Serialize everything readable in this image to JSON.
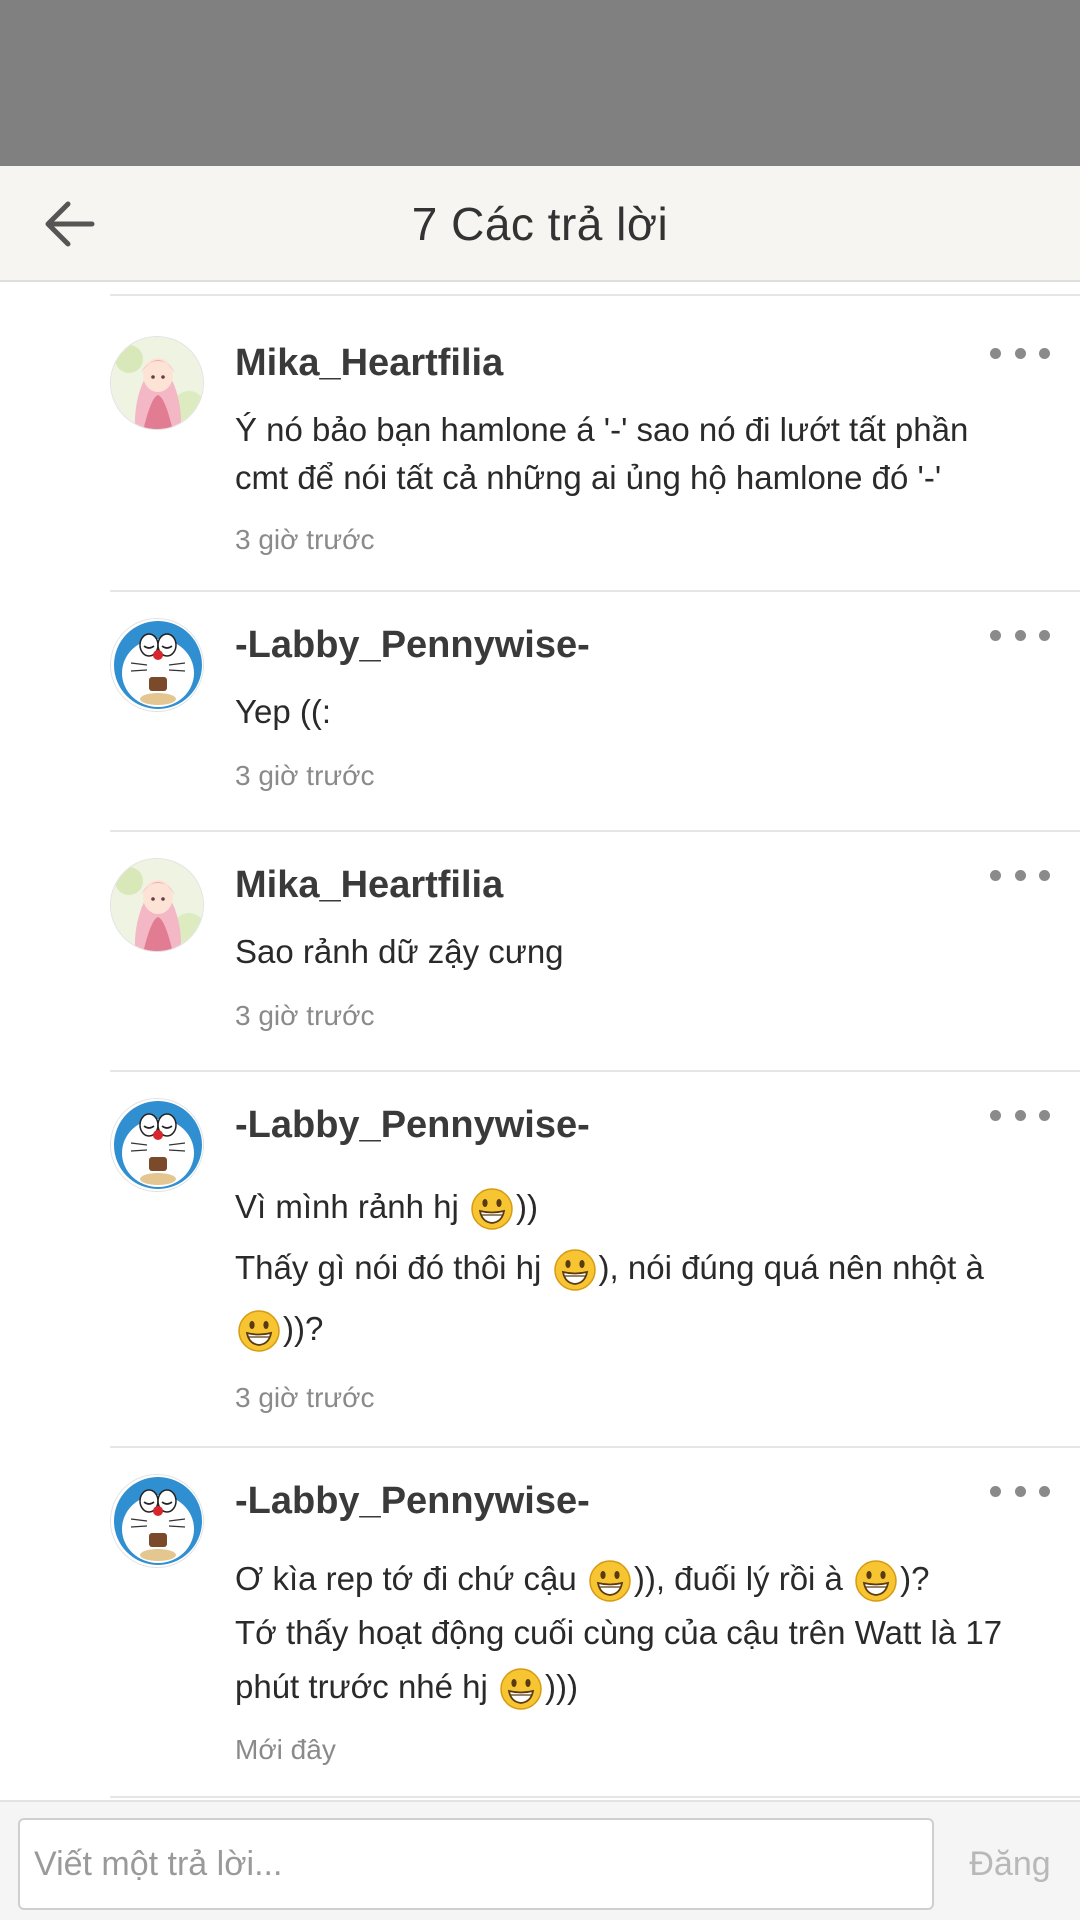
{
  "header": {
    "title": "7 Các trả lời",
    "back_icon": "arrow-left-icon"
  },
  "comments": [
    {
      "username": "Mika_Heartfilia",
      "avatar": "anime-girl-avatar",
      "lines": [
        [
          "Ý nó bảo bạn hamlone á '-' sao nó đi lướt tất phần"
        ],
        [
          "cmt để nói tất cả những ai ủng hộ hamlone đó '-'"
        ]
      ],
      "time": "3 giờ trước"
    },
    {
      "username": "-Labby_Pennywise-",
      "avatar": "doraemon-avatar",
      "lines": [
        [
          "Yep ((:"
        ]
      ],
      "time": "3 giờ trước"
    },
    {
      "username": "Mika_Heartfilia",
      "avatar": "anime-girl-avatar",
      "lines": [
        [
          "Sao rảnh dữ zậy cưng"
        ]
      ],
      "time": "3 giờ trước"
    },
    {
      "username": "-Labby_Pennywise-",
      "avatar": "doraemon-avatar",
      "lines": [
        [
          "Vì mình rảnh hj ",
          "grinning-face-emoji",
          "))"
        ],
        [
          "Thấy gì nói đó thôi hj ",
          "grinning-face-emoji",
          "), nói đúng quá nên nhột à"
        ],
        [
          "grinning-face-emoji",
          "))?"
        ]
      ],
      "time": "3 giờ trước"
    },
    {
      "username": "-Labby_Pennywise-",
      "avatar": "doraemon-avatar",
      "lines": [
        [
          "Ơ kìa rep tớ đi chứ cậu ",
          "grinning-face-emoji",
          ")), đuối lý rồi à ",
          "grinning-face-emoji",
          ")?"
        ],
        [
          "Tớ thấy hoạt động cuối cùng của cậu trên Watt là 17"
        ],
        [
          "phút trước nhé hj ",
          "grinning-face-emoji",
          ")))"
        ]
      ],
      "time": "Mới đây"
    }
  ],
  "footer": {
    "placeholder": "Viết một trả lời...",
    "post_label": "Đăng"
  },
  "colors": {
    "status_bar": "#808080",
    "header_bg": "#f6f5f1",
    "divider": "#e6e6e6",
    "muted_text": "#8a8a8a",
    "post_disabled": "#b8b8b8"
  }
}
